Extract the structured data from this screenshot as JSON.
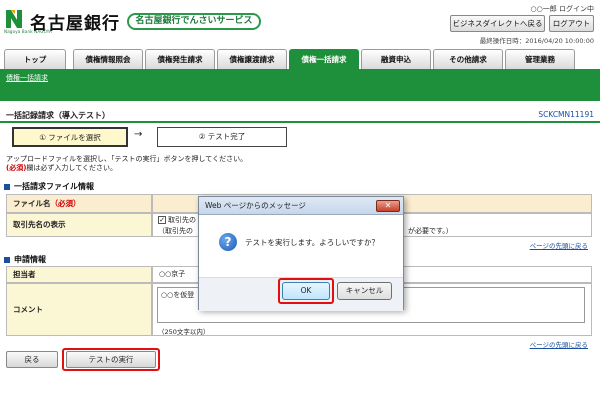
{
  "header": {
    "bank_name": "名古屋銀行",
    "logo_sub": "Nagoya Bank NAGOYA",
    "service_name": "名古屋銀行でんさいサービス",
    "user": "○○一郎 ログイン中",
    "business_direct_button": "ビジネスダイレクトへ戻る",
    "logout_button": "ログアウト",
    "last_operation": "最終操作日時：2016/04/20 10:00:00"
  },
  "tabs": [
    {
      "label": "トップ"
    },
    {
      "label": "債権情報照会"
    },
    {
      "label": "債権発生請求"
    },
    {
      "label": "債権譲渡請求"
    },
    {
      "label": "債権一括請求"
    },
    {
      "label": "融資申込"
    },
    {
      "label": "その他請求"
    },
    {
      "label": "管理業務"
    }
  ],
  "subnav": "債権一括請求",
  "page": {
    "title": "一括記録請求（導入テスト）",
    "screen_id": "SCKCMN11191"
  },
  "steps": [
    {
      "label": "① ファイルを選択"
    },
    {
      "label": "② テスト完了"
    }
  ],
  "step_arrow": "→",
  "instructions": {
    "line1": "アップロードファイルを選択し、「テストの実行」ボタンを押してください。",
    "line2_badge": "(必須)",
    "line2_text": "欄は必ず入力してください。"
  },
  "file_section": {
    "title": "一括請求ファイル情報",
    "file_label": "ファイル名",
    "file_required": "（必須）",
    "display_label": "取引先名の表示",
    "checkbox_text": "取引先の",
    "note_left": "（取引先の",
    "note_right": "が必要です。）",
    "back_to_top": "ページの先頭に戻る"
  },
  "apply_section": {
    "title": "申請情報",
    "tanto_label": "担当者",
    "tanto_value": "○○京子",
    "comment_label": "コメント",
    "comment_value": "○○を仮登",
    "char_limit": "（250文字以内）",
    "back_to_top": "ページの先頭に戻る"
  },
  "footer": {
    "back_button": "戻る",
    "run_button": "テストの実行"
  },
  "dialog": {
    "title": "Web ページからのメッセージ",
    "close_glyph": "✕",
    "icon_glyph": "?",
    "message": "テストを実行します。よろしいですか？",
    "ok": "OK",
    "cancel": "キャンセル"
  },
  "colors": {
    "brand_green": "#1e8f3a",
    "highlight_red": "#e01010",
    "link_blue": "#1a4fa0"
  }
}
